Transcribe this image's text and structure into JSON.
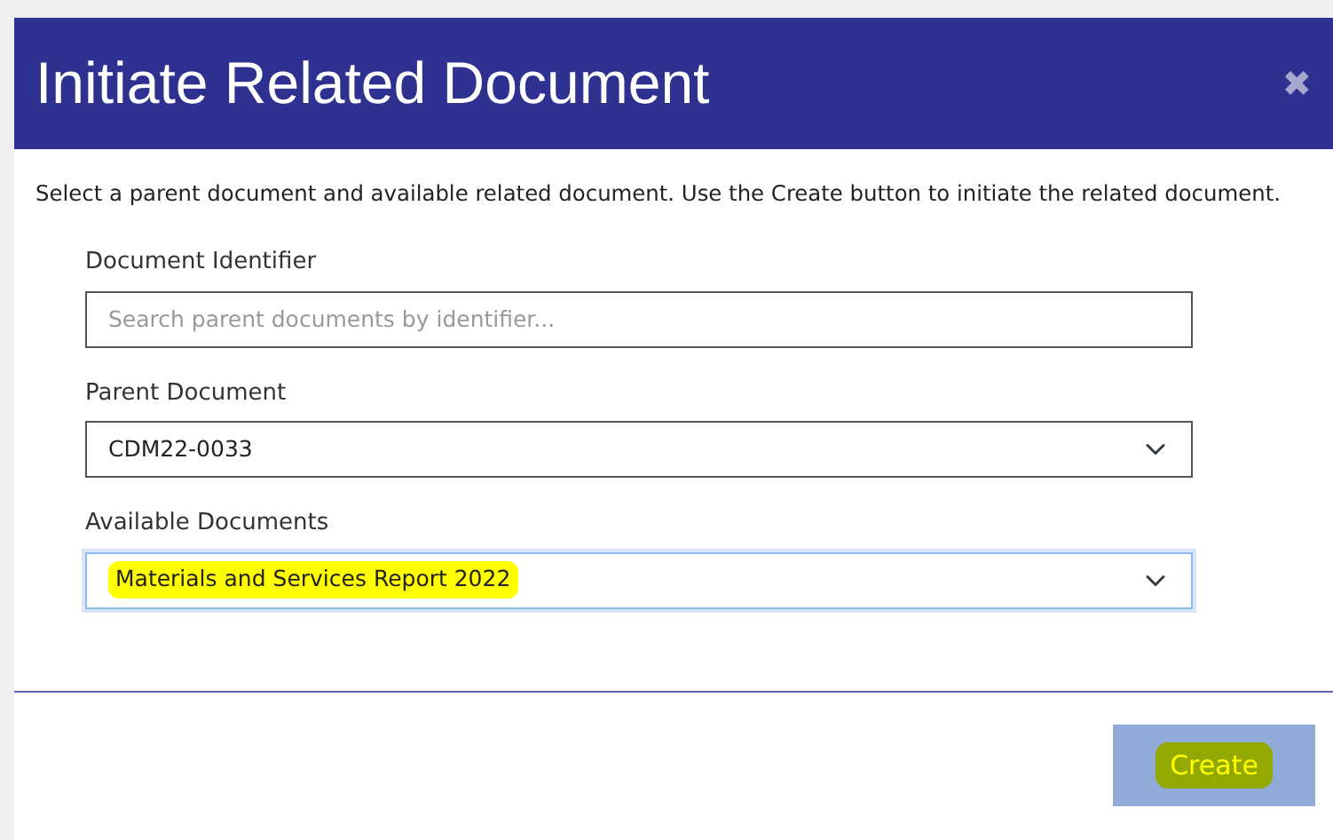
{
  "dialog": {
    "title": "Initiate Related Document",
    "close": "✖",
    "description": "Select a parent document and available related document. Use the Create button to initiate the related document."
  },
  "fields": [
    {
      "kind": "text",
      "label": "Document Identifier",
      "placeholder": "Search parent documents by identifier...",
      "focused": false,
      "highlighted": false
    },
    {
      "kind": "select",
      "label": "Parent Document",
      "value": "CDM22-0033",
      "focused": false,
      "highlighted": false
    },
    {
      "kind": "select",
      "label": "Available Documents",
      "value": "Materials and Services Report 2022",
      "focused": true,
      "highlighted": true
    }
  ],
  "button": {
    "label": "Create",
    "disabled": true,
    "highlighted": true
  }
}
